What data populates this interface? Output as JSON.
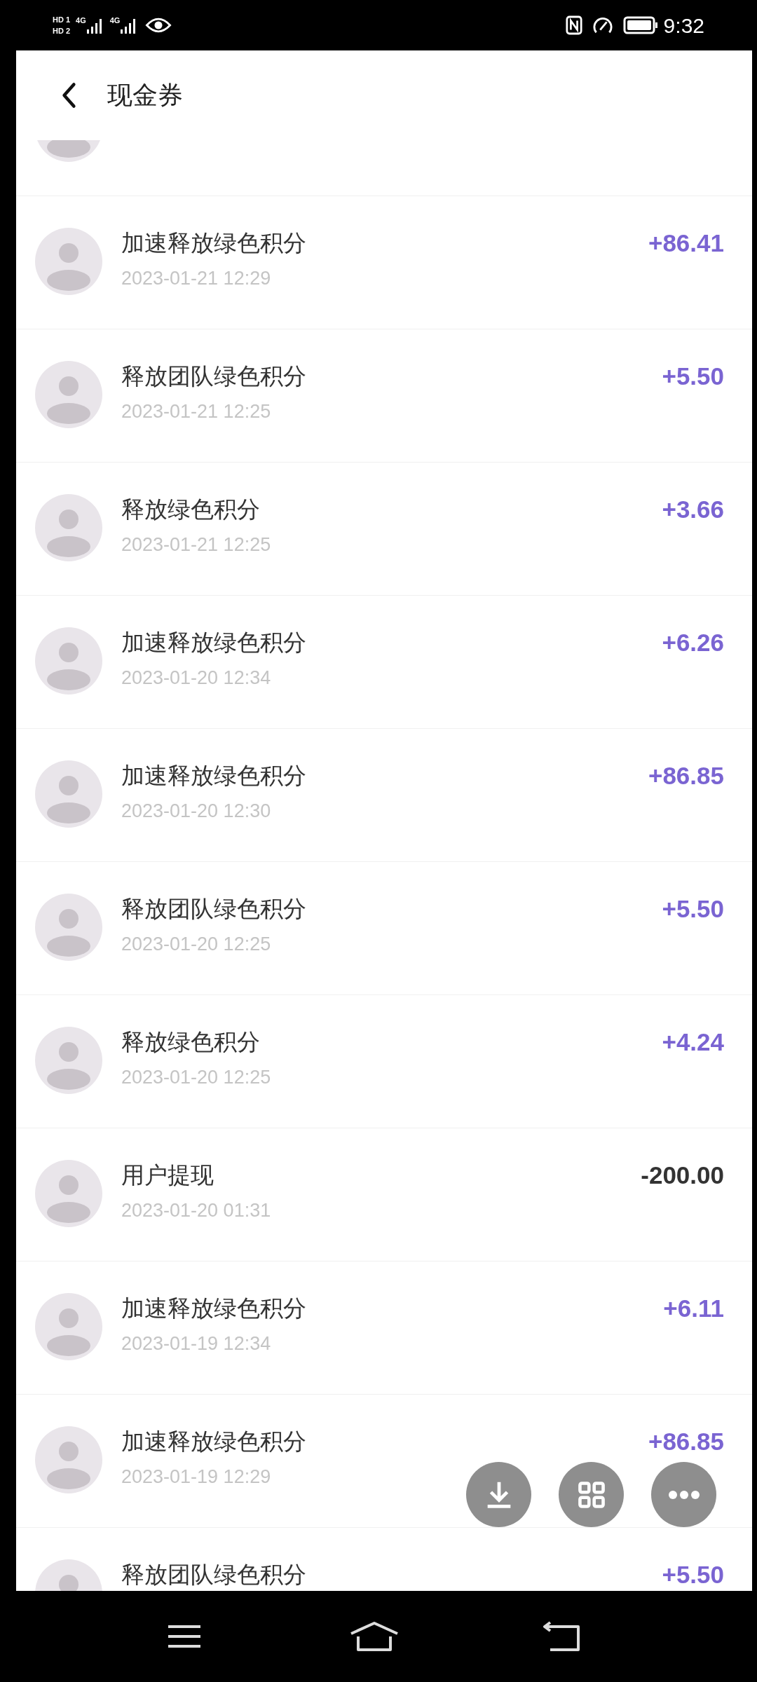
{
  "status_bar": {
    "hd_badges": [
      "HD 1",
      "HD 2"
    ],
    "network_labels": [
      "4G",
      "4G"
    ],
    "time": "9:32"
  },
  "header": {
    "title": "现金券"
  },
  "transactions": [
    {
      "title": "加速释放绿色积分",
      "date": "2023-01-21 12:29",
      "amount": "+86.41",
      "kind": "income"
    },
    {
      "title": "释放团队绿色积分",
      "date": "2023-01-21 12:25",
      "amount": "+5.50",
      "kind": "income"
    },
    {
      "title": "释放绿色积分",
      "date": "2023-01-21 12:25",
      "amount": "+3.66",
      "kind": "income"
    },
    {
      "title": "加速释放绿色积分",
      "date": "2023-01-20 12:34",
      "amount": "+6.26",
      "kind": "income"
    },
    {
      "title": "加速释放绿色积分",
      "date": "2023-01-20 12:30",
      "amount": "+86.85",
      "kind": "income"
    },
    {
      "title": "释放团队绿色积分",
      "date": "2023-01-20 12:25",
      "amount": "+5.50",
      "kind": "income"
    },
    {
      "title": "释放绿色积分",
      "date": "2023-01-20 12:25",
      "amount": "+4.24",
      "kind": "income"
    },
    {
      "title": "用户提现",
      "date": "2023-01-20 01:31",
      "amount": "-200.00",
      "kind": "expense"
    },
    {
      "title": "加速释放绿色积分",
      "date": "2023-01-19 12:34",
      "amount": "+6.11",
      "kind": "income"
    },
    {
      "title": "加速释放绿色积分",
      "date": "2023-01-19 12:29",
      "amount": "+86.85",
      "kind": "income"
    },
    {
      "title": "释放团队绿色积分",
      "amount": "+5.50",
      "kind": "income"
    }
  ]
}
